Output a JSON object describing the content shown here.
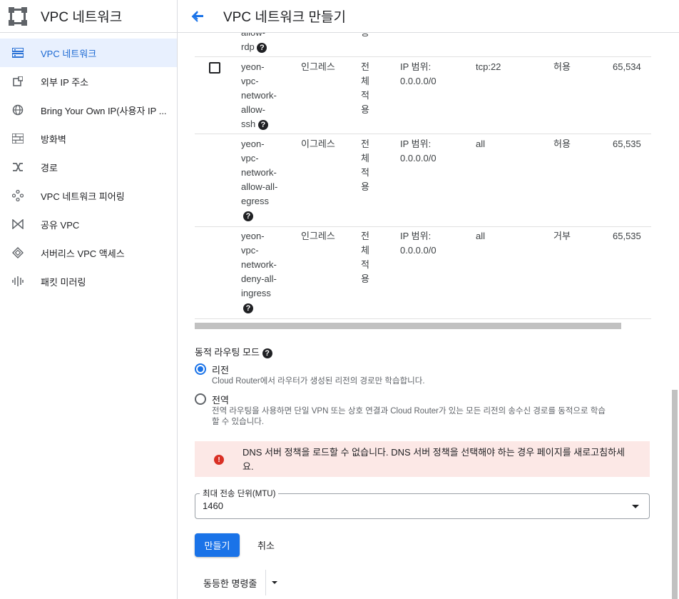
{
  "sidebar": {
    "title": "VPC 네트워크",
    "items": [
      {
        "label": "VPC 네트워크",
        "icon": "vpc-network-icon",
        "active": true
      },
      {
        "label": "외부 IP 주소",
        "icon": "external-ip-icon"
      },
      {
        "label": "Bring Your Own IP(사용자 IP ...",
        "icon": "globe-icon"
      },
      {
        "label": "방화벽",
        "icon": "firewall-icon"
      },
      {
        "label": "경로",
        "icon": "routes-icon"
      },
      {
        "label": "VPC 네트워크 피어링",
        "icon": "peering-icon"
      },
      {
        "label": "공유 VPC",
        "icon": "shared-vpc-icon"
      },
      {
        "label": "서버리스 VPC 액세스",
        "icon": "serverless-icon"
      },
      {
        "label": "패킷 미러링",
        "icon": "packet-mirroring-icon"
      }
    ]
  },
  "header": {
    "title": "VPC 네트워크 만들기"
  },
  "firewall_rows": [
    {
      "name_lines": [
        "allow-",
        "rdp"
      ],
      "has_checkbox": false,
      "partial": true,
      "direction": "",
      "target_lines": [
        "용"
      ],
      "filter_lines": [],
      "protocol": "",
      "action": "",
      "priority": ""
    },
    {
      "name_lines": [
        "yeon-",
        "vpc-",
        "network-",
        "allow-",
        "ssh"
      ],
      "has_checkbox": true,
      "direction": "인그레스",
      "target_lines": [
        "전",
        "체",
        "적",
        "용"
      ],
      "filter_lines": [
        "IP 범위:",
        "0.0.0.0/0"
      ],
      "protocol": "tcp:22",
      "action": "허용",
      "priority": "65,534"
    },
    {
      "name_lines": [
        "yeon-",
        "vpc-",
        "network-",
        "allow-all-",
        "egress"
      ],
      "has_checkbox": false,
      "direction": "이그레스",
      "target_lines": [
        "전",
        "체",
        "적",
        "용"
      ],
      "filter_lines": [
        "IP 범위:",
        "0.0.0.0/0"
      ],
      "protocol": "all",
      "action": "허용",
      "priority": "65,535"
    },
    {
      "name_lines": [
        "yeon-",
        "vpc-",
        "network-",
        "deny-all-",
        "ingress"
      ],
      "has_checkbox": false,
      "direction": "인그레스",
      "target_lines": [
        "전",
        "체",
        "적",
        "용"
      ],
      "filter_lines": [
        "IP 범위:",
        "0.0.0.0/0"
      ],
      "protocol": "all",
      "action": "거부",
      "priority": "65,535"
    }
  ],
  "routing": {
    "label": "동적 라우팅 모드",
    "options": [
      {
        "label": "리전",
        "desc": "Cloud Router에서 라우터가 생성된 리전의 경로만 학습합니다.",
        "checked": true
      },
      {
        "label": "전역",
        "desc_line1": "전역 라우팅을 사용하면 단일 VPN 또는 상호 연결과 Cloud Router가 있는 모든 리전의 송수신 경로를 동적으로 학습",
        "desc_line2": "할 수 있습니다.",
        "checked": false
      }
    ]
  },
  "error": {
    "line1": "DNS 서버 정책을 로드할 수 없습니다. DNS 서버 정책을 선택해야 하는 경우 페이지를 새로고침하세",
    "line2": "요."
  },
  "mtu": {
    "label": "최대 전송 단위(MTU)",
    "value": "1460"
  },
  "buttons": {
    "create": "만들기",
    "cancel": "취소",
    "equivalent_command": "동등한 명령줄"
  },
  "colors": {
    "accent": "#1a73e8",
    "active_bg": "#e8f0fe",
    "error_bg": "#fce8e6",
    "error_icon": "#d93025"
  }
}
